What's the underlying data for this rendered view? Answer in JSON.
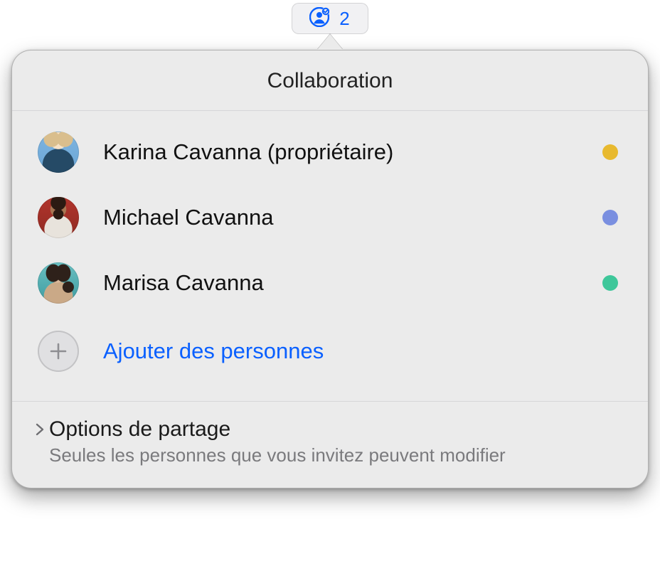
{
  "toolbar": {
    "participant_count": "2"
  },
  "popover": {
    "title": "Collaboration",
    "people": [
      {
        "name": "Karina Cavanna (propriétaire)",
        "dot_color": "#e8b92e"
      },
      {
        "name": "Michael Cavanna",
        "dot_color": "#7a8fe0"
      },
      {
        "name": "Marisa Cavanna",
        "dot_color": "#3ec79a"
      }
    ],
    "add_label": "Ajouter des personnes",
    "footer": {
      "title": "Options de partage",
      "subtitle": "Seules les personnes que vous invitez peuvent modifier"
    }
  }
}
